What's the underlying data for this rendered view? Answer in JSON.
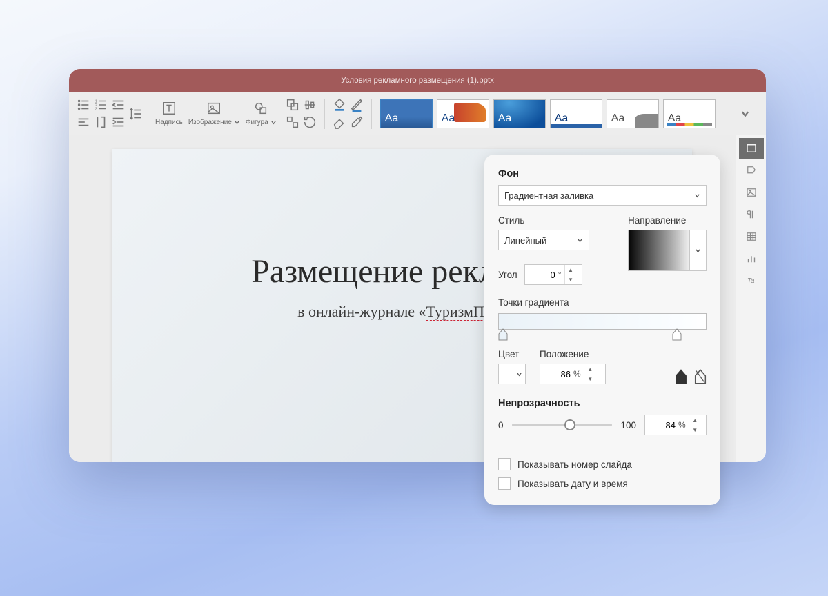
{
  "titlebar": {
    "filename": "Условия рекламного размещения (1).pptx"
  },
  "toolbar": {
    "textbox_label": "Надпись",
    "image_label": "Изображение",
    "shape_label": "Фигура",
    "theme_sample": "Aa"
  },
  "slide": {
    "title": "Размещение рекламы",
    "subtitle_prefix": "в онлайн-журнале «",
    "subtitle_underlined": "ТуризмПро",
    "subtitle_suffix": "»"
  },
  "panel": {
    "bg_label": "Фон",
    "bg_value": "Градиентная заливка",
    "style_label": "Стиль",
    "style_value": "Линейный",
    "direction_label": "Направление",
    "angle_label": "Угол",
    "angle_value": "0",
    "angle_unit": "°",
    "stops_label": "Точки градиента",
    "color_label": "Цвет",
    "position_label": "Положение",
    "position_value": "86",
    "position_unit": "%",
    "opacity_label": "Непрозрачность",
    "opacity_min": "0",
    "opacity_max": "100",
    "opacity_value": "84",
    "opacity_unit": "%",
    "show_number_label": "Показывать номер слайда",
    "show_date_label": "Показывать дату и время",
    "gradient_stops": [
      {
        "position_pct": 2,
        "color": "#eaf2f8"
      },
      {
        "position_pct": 86,
        "color": "#ffffff"
      }
    ],
    "opacity_pct": 84
  }
}
